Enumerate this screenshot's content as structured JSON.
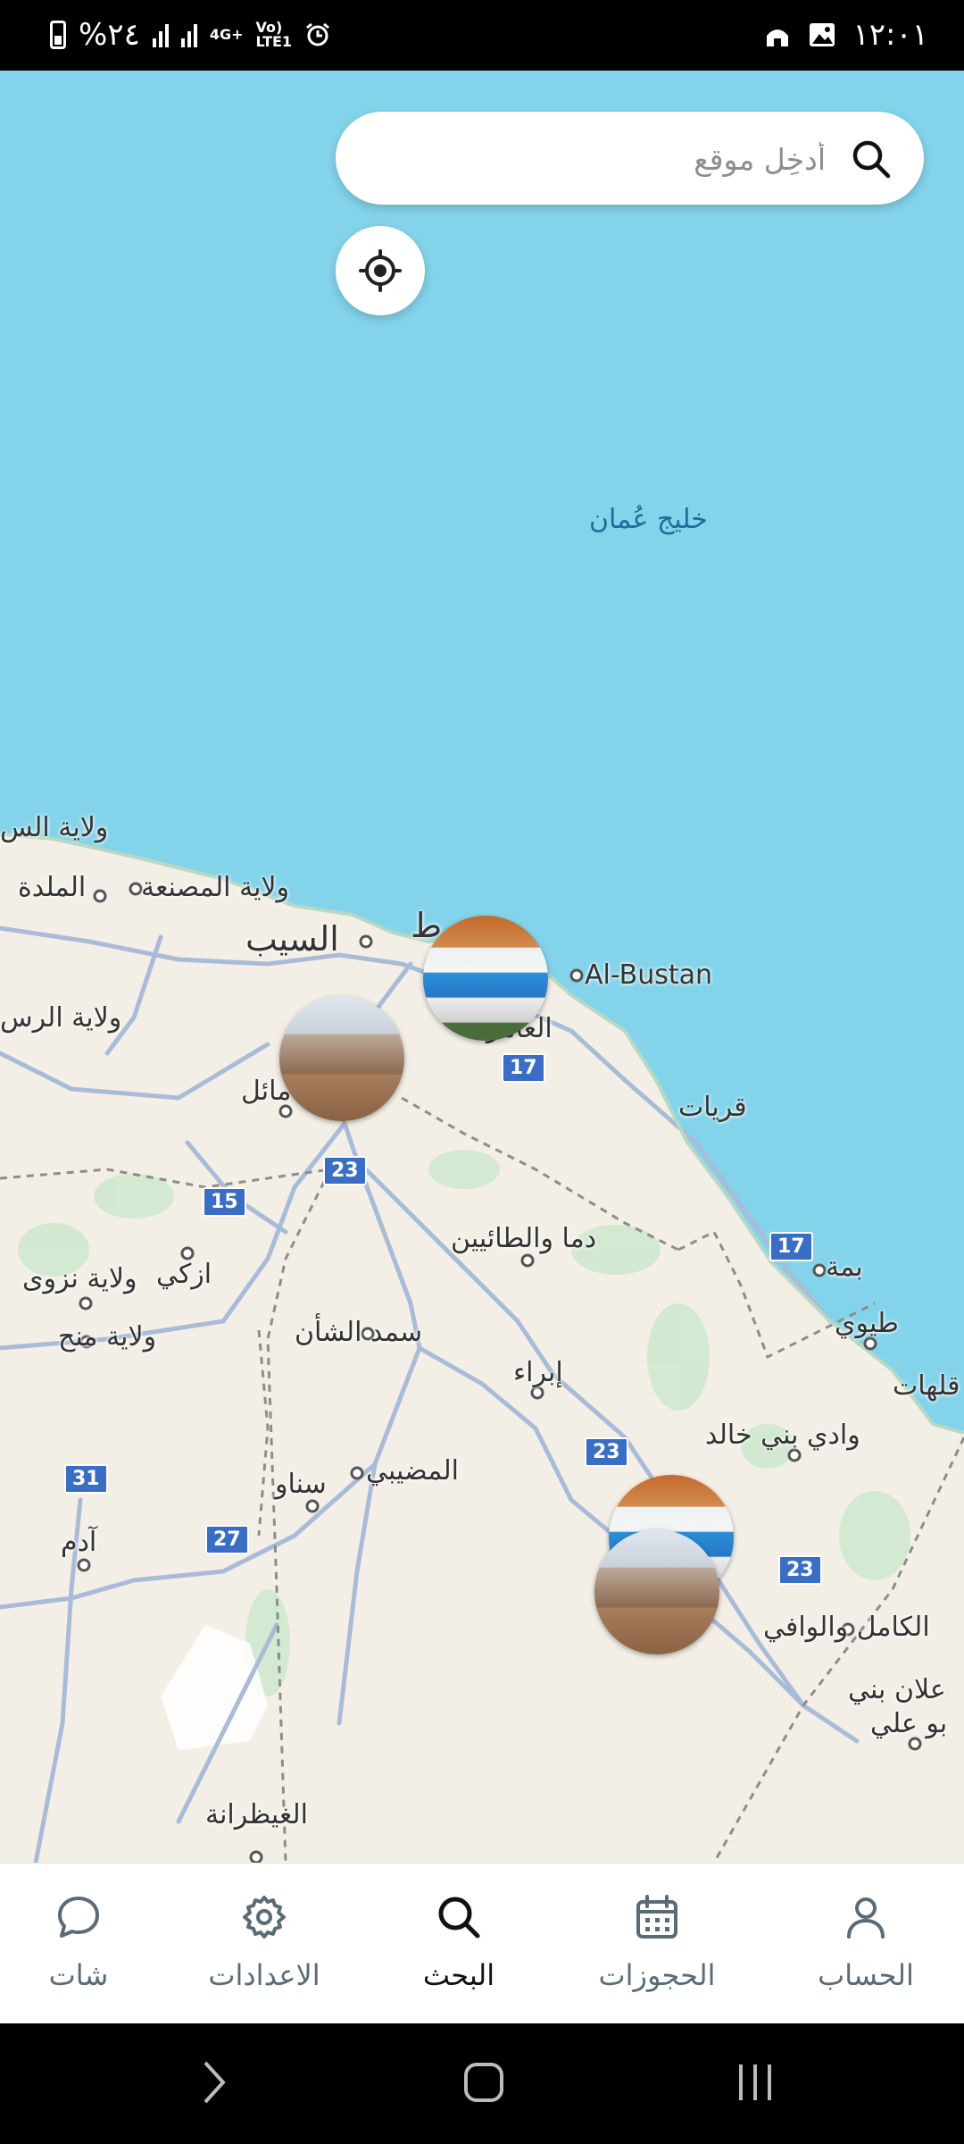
{
  "status_bar": {
    "battery_text": "%٢٤",
    "network": "4G+",
    "volte_top": "Vo)",
    "volte_bottom": "LTE1",
    "time": "١٢:٠١"
  },
  "search": {
    "placeholder": "أدخِل موقع"
  },
  "map": {
    "sea_label": "خليج عُمان",
    "places": {
      "seeb": "السيب",
      "sur_label": "ولاية الس",
      "musanaa": "ولاية المصنعة",
      "mulada": "الملدة",
      "rustaq": "ولاية الرس",
      "al_bustan": "Al-Bustan",
      "amerat": "العامر",
      "muscat_partial": "ط",
      "quriyat": "قريات",
      "samail": "مائل",
      "dima": "دما والطائيين",
      "bimah": "بمة",
      "tiwi": "طيوي",
      "izki": "ازكي",
      "nizwa": "ولاية نزوى",
      "manah": "ولاية منح",
      "samad": "سمد الشأن",
      "ibra": "إبراء",
      "wadi_bani_khalid": "وادي بني خالد",
      "qalhat": "قلهات",
      "mudhaibi": "المضيبي",
      "sinaw": "سناو",
      "adam": "آدم",
      "kamil": "الكامل والوافي",
      "jaalan": "علان بني",
      "bu_ali": "بو علي",
      "ghayzarana": "الغيظرانة"
    },
    "routes": {
      "r17a": "17",
      "r23a": "23",
      "r15": "15",
      "r17b": "17",
      "r23b": "23",
      "r31": "31",
      "r27": "27",
      "r23c": "23"
    }
  },
  "bottom_nav": {
    "items": [
      {
        "label": "شات",
        "icon": "chat-icon"
      },
      {
        "label": "الاعدادات",
        "icon": "gear-icon"
      },
      {
        "label": "البحث",
        "icon": "search-icon",
        "active": true
      },
      {
        "label": "الحجوزات",
        "icon": "calendar-icon"
      },
      {
        "label": "الحساب",
        "icon": "person-icon"
      }
    ]
  },
  "colors": {
    "sea": "#83d3ea",
    "land": "#f3efe6",
    "road": "#9fb4d6",
    "route_shield": "#3a6dc4",
    "nav_active": "#111111",
    "nav_inactive": "#5b6b76"
  }
}
